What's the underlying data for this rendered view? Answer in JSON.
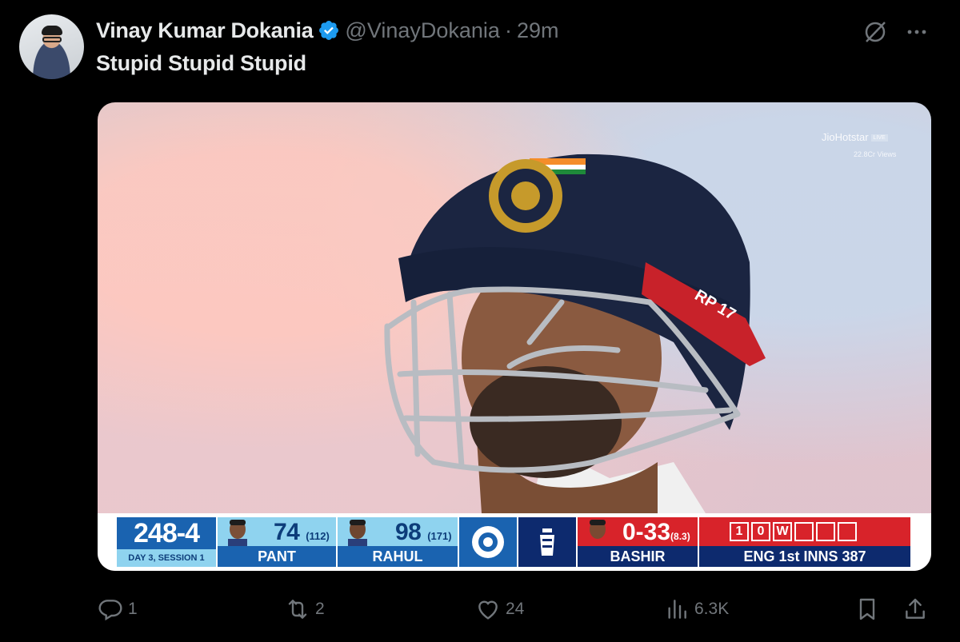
{
  "tweet": {
    "author_name": "Vinay Kumar Dokania",
    "handle": "@VinayDokania",
    "separator": "·",
    "time": "29m",
    "text": "Stupid Stupid Stupid"
  },
  "media": {
    "broadcaster": "JioHotstar",
    "live_badge": "LIVE",
    "views": "22.8Cr Views",
    "helmet_sticker": "RP 17",
    "scoreboard": {
      "total": "248-4",
      "session": "DAY 3, SESSION 1",
      "batters": [
        {
          "name": "PANT",
          "runs": "74",
          "balls": "(112)"
        },
        {
          "name": "RAHUL",
          "runs": "98",
          "balls": "(171)"
        }
      ],
      "bowler": {
        "name": "BASHIR",
        "figures": "0-33",
        "overs": "(8.3)"
      },
      "this_over": [
        "1",
        "0",
        "W",
        "",
        "",
        ""
      ],
      "innings": "ENG 1st INNS  387"
    }
  },
  "actions": {
    "replies": "1",
    "reposts": "2",
    "likes": "24",
    "views": "6.3K"
  },
  "colors": {
    "background": "#000000",
    "text_primary": "#e7e9ea",
    "text_secondary": "#71767b",
    "verified": "#1d9bf0",
    "india_blue": "#1a63b0",
    "india_light": "#8fd3ef",
    "eng_red": "#d8232a",
    "eng_navy": "#0d2a6e"
  }
}
